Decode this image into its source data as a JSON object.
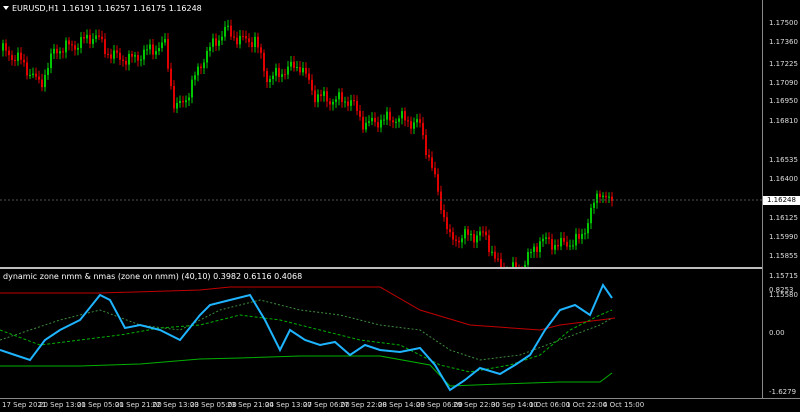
{
  "header": {
    "symbol": "EURUSD,H1",
    "open": "1.16191",
    "high": "1.16257",
    "low": "1.16175",
    "close": "1.16248",
    "menu_icon": "triangle-down-icon"
  },
  "indicator": {
    "title": "dynamic zone nmm & nmas (zone on nmm) (40,10) 0.3982 0.6116 0.4068",
    "levels": [
      "0.8253",
      "0.00",
      "-1.6279"
    ]
  },
  "price_axis": {
    "labels": [
      "1.17500",
      "1.17360",
      "1.17225",
      "1.17090",
      "1.16950",
      "1.16810",
      "1.16535",
      "1.16400",
      "1.16125",
      "1.15990",
      "1.15855",
      "1.15715",
      "1.15580"
    ],
    "current": "1.16248"
  },
  "time_axis": {
    "labels": [
      "17 Sep 2021",
      "20 Sep 13:00",
      "21 Sep 05:00",
      "21 Sep 21:00",
      "22 Sep 13:00",
      "23 Sep 05:00",
      "23 Sep 21:00",
      "24 Sep 13:00",
      "27 Sep 06:00",
      "27 Sep 22:00",
      "28 Sep 14:00",
      "29 Sep 06:00",
      "29 Sep 22:00",
      "30 Sep 14:00",
      "1 Oct 06:00",
      "1 Oct 22:00",
      "4 Oct 15:00"
    ]
  },
  "colors": {
    "bull": "#00c800",
    "bear": "#e00000",
    "blue": "#1fb4ff",
    "red_line": "#c00000",
    "green_line": "#00b000",
    "dotted": "#3c8c3c"
  }
}
